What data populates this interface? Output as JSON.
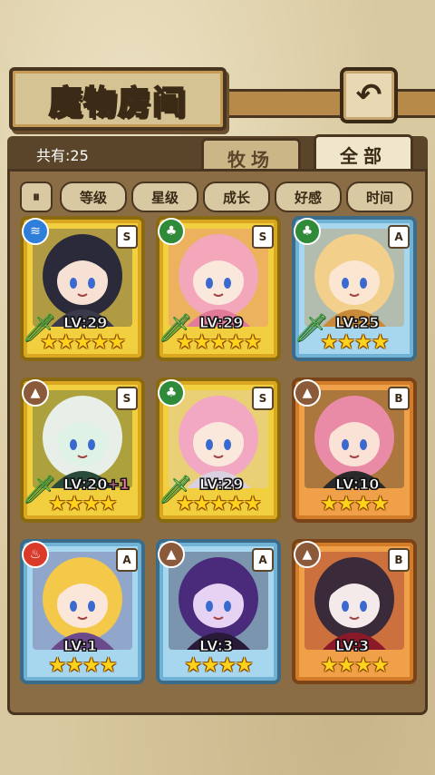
{
  "header": {
    "title": "魔物房间",
    "back_icon": "back-arrow-icon"
  },
  "tabs": {
    "count_label": "共有:25",
    "farm_label": "牧场",
    "all_label": "全部",
    "active": "all"
  },
  "filters": {
    "sort_icon": "sort-order-icon",
    "level": "等级",
    "star": "星级",
    "growth": "成长",
    "affinity": "好感",
    "time": "时间"
  },
  "monsters": [
    {
      "element": "water",
      "element_icon": "water-element-icon",
      "rank": "S",
      "level": "LV:29",
      "bonus": "",
      "stars": 5,
      "stars_text": "★★★★★",
      "frame": "gold",
      "sword": true,
      "hair": "#2b2a3a",
      "skin": "#f6e1d4",
      "outfit": "#3a3a4a"
    },
    {
      "element": "grass",
      "element_icon": "grass-element-icon",
      "rank": "S",
      "level": "LV:29",
      "bonus": "",
      "stars": 5,
      "stars_text": "★★★★★",
      "frame": "gold",
      "sword": true,
      "hair": "#f4a6ba",
      "skin": "#fbe8dc",
      "outfit": "#e27a9a"
    },
    {
      "element": "grass",
      "element_icon": "grass-element-icon",
      "rank": "A",
      "level": "LV:25",
      "bonus": "",
      "stars": 4,
      "stars_text": "★★★★",
      "frame": "blue",
      "sword": true,
      "hair": "#f2cf8a",
      "skin": "#fbe6d2",
      "outfit": "#c98a3a"
    },
    {
      "element": "earth",
      "element_icon": "earth-element-icon",
      "rank": "S",
      "level": "LV:20",
      "bonus": "+1",
      "stars": 4,
      "stars_text": "★★★★",
      "frame": "gold",
      "sword": true,
      "hair": "#e8efe8",
      "skin": "#dff2e6",
      "outfit": "#2a4a3a"
    },
    {
      "element": "grass",
      "element_icon": "grass-element-icon",
      "rank": "S",
      "level": "LV:29",
      "bonus": "",
      "stars": 5,
      "stars_text": "★★★★★",
      "frame": "gold",
      "sword": true,
      "hair": "#f2a8c2",
      "skin": "#fbe8dc",
      "outfit": "#d9d0e0"
    },
    {
      "element": "earth",
      "element_icon": "earth-element-icon",
      "rank": "B",
      "level": "LV:10",
      "bonus": "",
      "stars": 4,
      "stars_text": "★★★★",
      "frame": "orange",
      "sword": false,
      "hair": "#e98aa6",
      "skin": "#fbe2d6",
      "outfit": "#2a2a2a"
    },
    {
      "element": "fire",
      "element_icon": "fire-element-icon",
      "rank": "A",
      "level": "LV:1",
      "bonus": "",
      "stars": 4,
      "stars_text": "★★★★",
      "frame": "blue",
      "sword": false,
      "hair": "#f4c94a",
      "skin": "#fbe6da",
      "outfit": "#6a4a8a"
    },
    {
      "element": "earth",
      "element_icon": "earth-element-icon",
      "rank": "A",
      "level": "LV:3",
      "bonus": "",
      "stars": 4,
      "stars_text": "★★★★",
      "frame": "blue",
      "sword": false,
      "hair": "#4a2a7a",
      "skin": "#e6d2f2",
      "outfit": "#2a1a3a"
    },
    {
      "element": "earth",
      "element_icon": "earth-element-icon",
      "rank": "B",
      "level": "LV:3",
      "bonus": "",
      "stars": 4,
      "stars_text": "★★★★",
      "frame": "orange",
      "sword": false,
      "hair": "#3a2a3a",
      "skin": "#f4eaea",
      "outfit": "#8a1a2a"
    }
  ]
}
